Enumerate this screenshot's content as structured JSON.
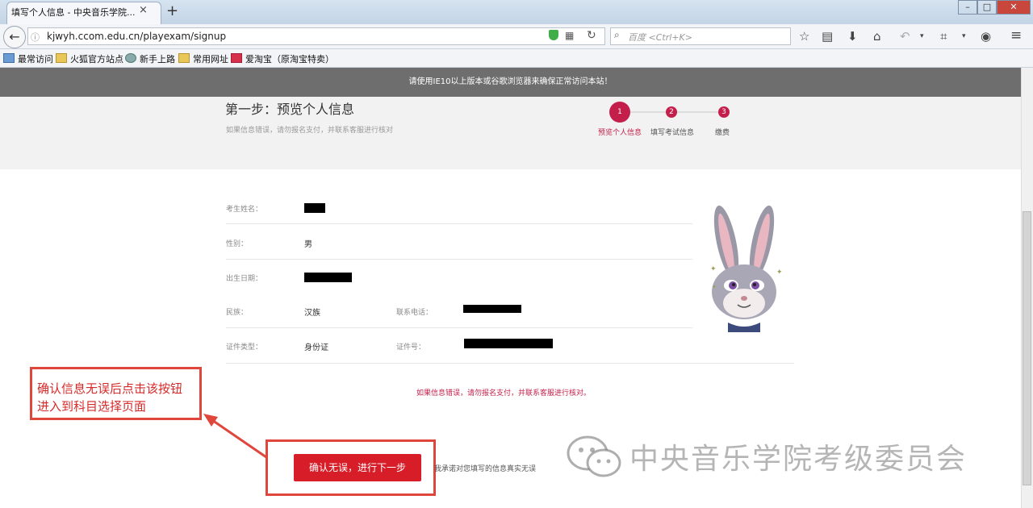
{
  "browser": {
    "tab_title": "填写个人信息 - 中央音乐学院...",
    "tab_close": "×",
    "new_tab": "+",
    "url": "kjwyh.ccom.edu.cn/playexam/signup",
    "search_placeholder": "百度 <Ctrl+K>",
    "bookmarks": [
      {
        "label": "最常访问",
        "icon": "bookmark-icon"
      },
      {
        "label": "火狐官方站点",
        "icon": "folder-icon"
      },
      {
        "label": "新手上路",
        "icon": "globe-icon"
      },
      {
        "label": "常用网址",
        "icon": "folder-icon"
      },
      {
        "label": "爱淘宝（原淘宝特卖）",
        "icon": "taobao-icon"
      }
    ]
  },
  "page": {
    "notice": "请使用IE10以上版本或谷歌浏览器来确保正常访问本站！",
    "step_title": "第一步：预览个人信息",
    "step_subtitle": "如果信息错误，请勿报名支付，并联系客服进行核对",
    "steps": [
      {
        "num": "1",
        "label": "预览个人信息",
        "active": true
      },
      {
        "num": "2",
        "label": "填写考试信息",
        "active": false
      },
      {
        "num": "3",
        "label": "缴费",
        "active": false
      }
    ],
    "fields": {
      "name_label": "考生姓名：",
      "gender_label": "性别：",
      "gender_value": "男",
      "birth_label": "出生日期：",
      "ethnicity_label": "民族：",
      "ethnicity_value": "汉族",
      "phone_label": "联系电话：",
      "id_type_label": "证件类型：",
      "id_type_value": "身份证",
      "id_number_label": "证件号："
    },
    "error_message": "如果信息错误，请勿报名支付，并联系客服进行核对。",
    "confirm_button": "确认无误，进行下一步",
    "promise_text": "我承诺对您填写的信息真实无误"
  },
  "annotation": {
    "line1": "确认信息无误后点击该按钮",
    "line2": "进入到科目选择页面"
  },
  "watermark": "中央音乐学院考级委员会",
  "colors": {
    "accent": "#c41e4a",
    "button": "#d71d28",
    "annotation": "#e0473c"
  }
}
